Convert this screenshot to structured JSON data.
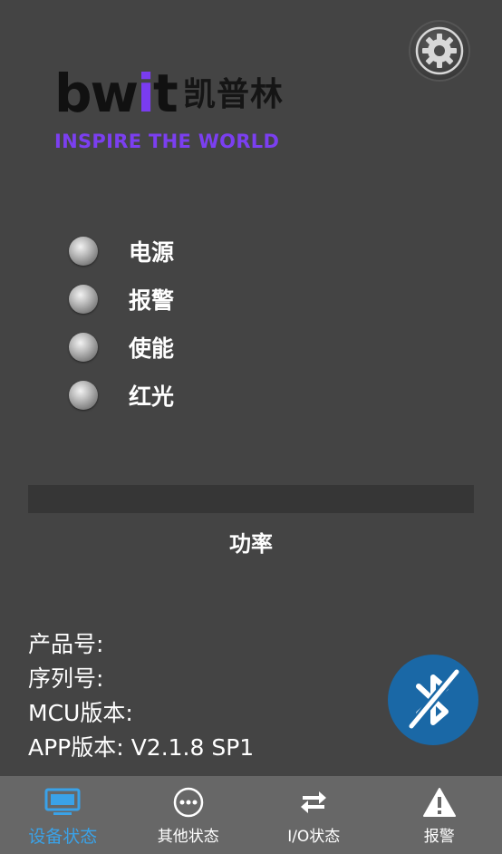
{
  "brand": {
    "wordmark_prefix": "bw",
    "wordmark_accent": "i",
    "wordmark_suffix": "t",
    "name_cn": "凯普林",
    "tagline": "INSPIRE THE WORLD"
  },
  "settings": {
    "icon": "gear-icon"
  },
  "status": [
    {
      "label": "电源"
    },
    {
      "label": "报警"
    },
    {
      "label": "使能"
    },
    {
      "label": "红光"
    }
  ],
  "power": {
    "label": "功率"
  },
  "info": {
    "product_label": "产品号:",
    "product_value": "",
    "serial_label": "序列号:",
    "serial_value": "",
    "mcu_label": "MCU版本:",
    "mcu_value": "",
    "app_label": "APP版本:",
    "app_value": "V2.1.8 SP1"
  },
  "bluetooth": {
    "icon": "bluetooth-disabled-icon"
  },
  "tabs": [
    {
      "label": "设备状态",
      "icon": "monitor-icon",
      "active": true
    },
    {
      "label": "其他状态",
      "icon": "more-icon",
      "active": false
    },
    {
      "label": "I/O状态",
      "icon": "swap-icon",
      "active": false
    },
    {
      "label": "报警",
      "icon": "warning-icon",
      "active": false
    }
  ],
  "colors": {
    "background": "#444444",
    "accent_blue": "#3aa2e8",
    "bluetooth_blue": "#1a68a6",
    "brand_purple": "#7b3ff0",
    "tabbar": "#676767"
  }
}
